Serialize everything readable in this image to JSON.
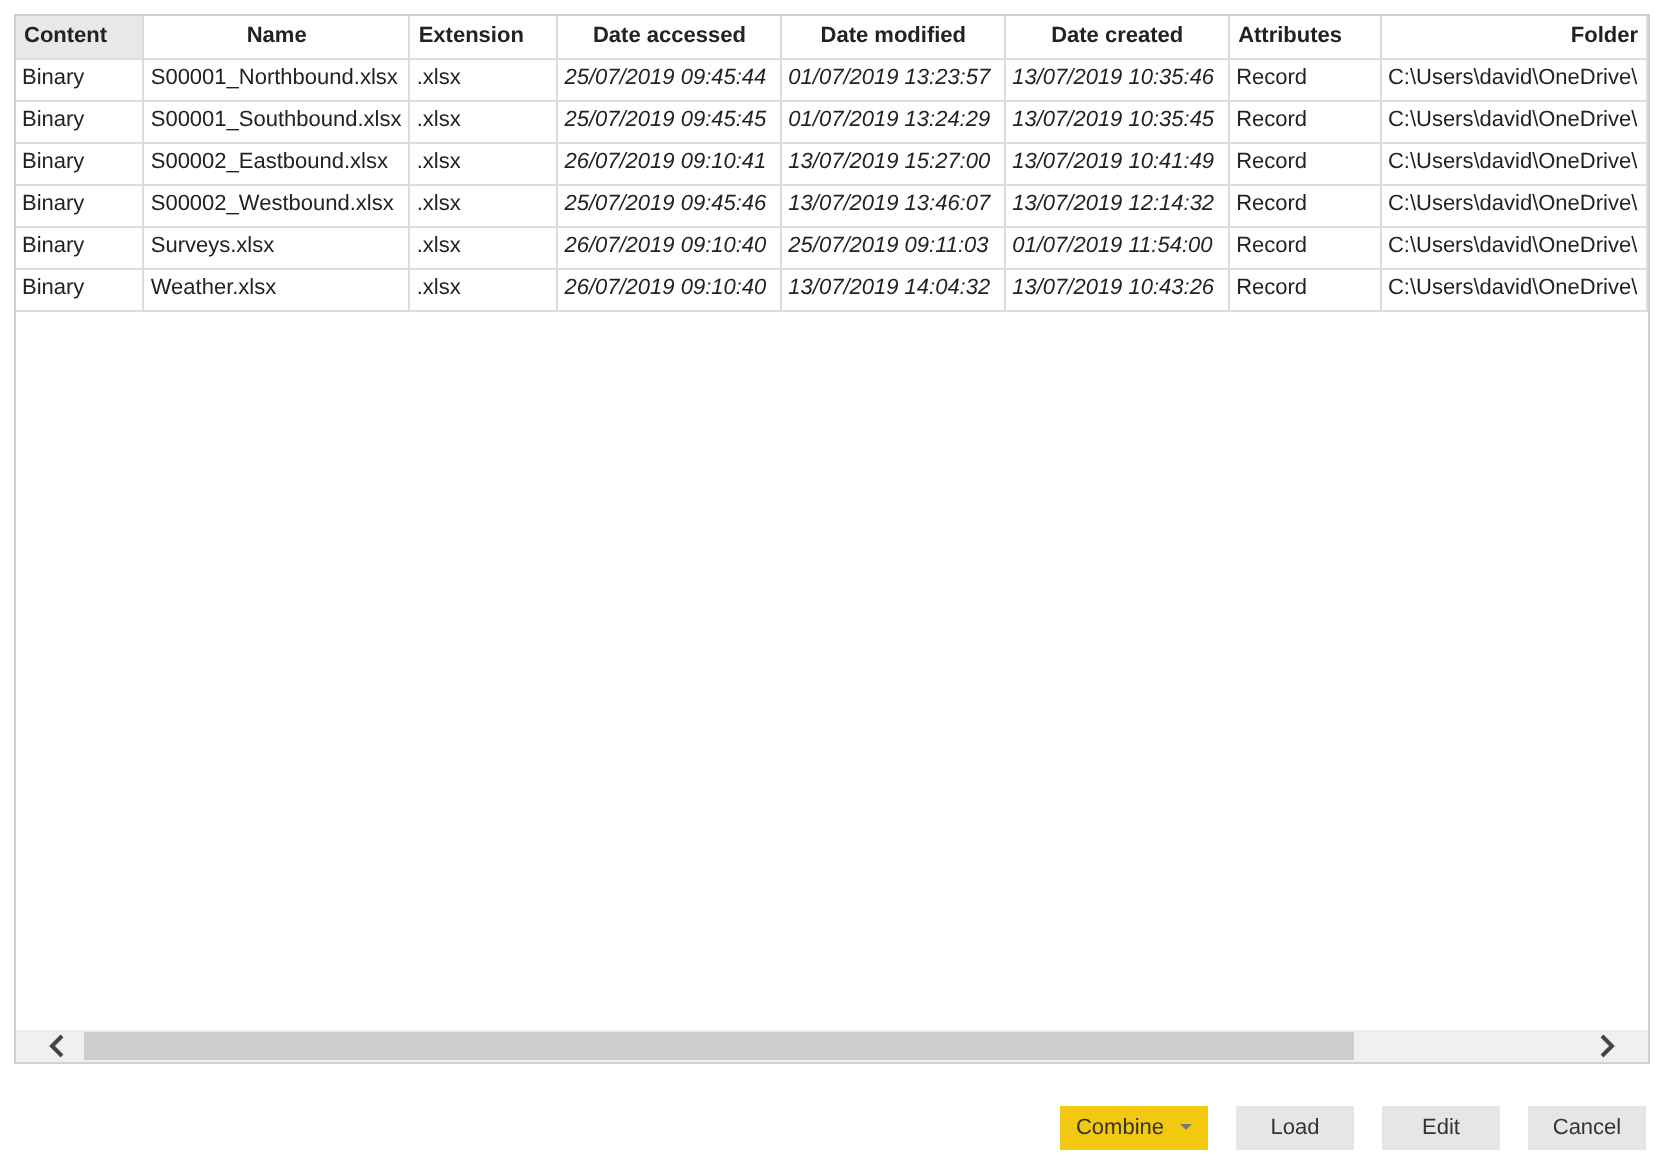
{
  "table": {
    "columns": [
      {
        "label": "Content",
        "selected": true
      },
      {
        "label": "Name",
        "selected": false
      },
      {
        "label": "Extension",
        "selected": false
      },
      {
        "label": "Date accessed",
        "selected": false
      },
      {
        "label": "Date modified",
        "selected": false
      },
      {
        "label": "Date created",
        "selected": false
      },
      {
        "label": "Attributes",
        "selected": false
      },
      {
        "label": "Folder",
        "selected": false
      }
    ],
    "rows": [
      [
        "Binary",
        "S00001_Northbound.xlsx",
        ".xlsx",
        "25/07/2019 09:45:44",
        "01/07/2019 13:23:57",
        "13/07/2019 10:35:46",
        "Record",
        "C:\\Users\\david\\OneDrive\\"
      ],
      [
        "Binary",
        "S00001_Southbound.xlsx",
        ".xlsx",
        "25/07/2019 09:45:45",
        "01/07/2019 13:24:29",
        "13/07/2019 10:35:45",
        "Record",
        "C:\\Users\\david\\OneDrive\\"
      ],
      [
        "Binary",
        "S00002_Eastbound.xlsx",
        ".xlsx",
        "26/07/2019 09:10:41",
        "13/07/2019 15:27:00",
        "13/07/2019 10:41:49",
        "Record",
        "C:\\Users\\david\\OneDrive\\"
      ],
      [
        "Binary",
        "S00002_Westbound.xlsx",
        ".xlsx",
        "25/07/2019 09:45:46",
        "13/07/2019 13:46:07",
        "13/07/2019 12:14:32",
        "Record",
        "C:\\Users\\david\\OneDrive\\"
      ],
      [
        "Binary",
        "Surveys.xlsx",
        ".xlsx",
        "26/07/2019 09:10:40",
        "25/07/2019 09:11:03",
        "01/07/2019 11:54:00",
        "Record",
        "C:\\Users\\david\\OneDrive\\"
      ],
      [
        "Binary",
        "Weather.xlsx",
        ".xlsx",
        "26/07/2019 09:10:40",
        "13/07/2019 14:04:32",
        "13/07/2019 10:43:26",
        "Record",
        "C:\\Users\\david\\OneDrive\\"
      ]
    ]
  },
  "buttons": [
    {
      "label": "Combine",
      "kind": "dropdown"
    },
    {
      "label": "Load",
      "kind": "plain"
    },
    {
      "label": "Edit",
      "kind": "plain"
    },
    {
      "label": "Cancel",
      "kind": "plain"
    }
  ]
}
